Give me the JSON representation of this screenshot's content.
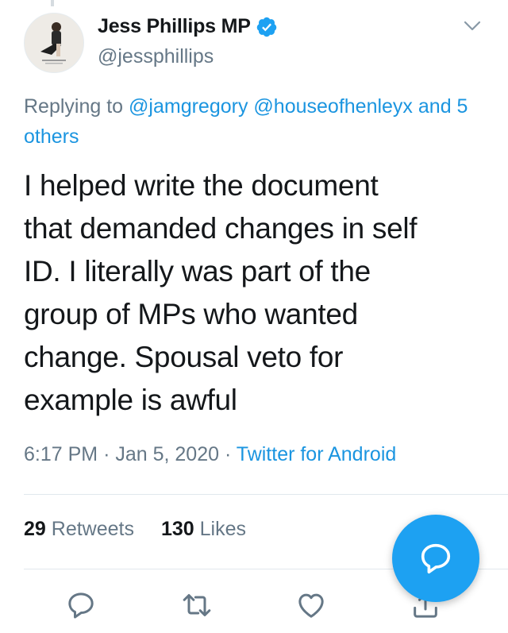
{
  "author": {
    "display_name": "Jess Phillips MP",
    "handle": "@jessphillips",
    "verified_icon": "verified-badge-icon"
  },
  "reply": {
    "prefix": "Replying to",
    "mention_1": "@jamgregory",
    "mention_2": "@houseofhenleyx",
    "others": "and 5 others"
  },
  "tweet": {
    "lines": [
      "I helped write the document",
      "that demanded changes in self",
      "ID. I literally was part of the",
      "group of MPs who wanted",
      "change. Spousal veto for",
      "example is awful"
    ]
  },
  "meta": {
    "time": "6:17 PM",
    "separator": "·",
    "date": "Jan 5, 2020",
    "source": "Twitter for Android"
  },
  "stats": {
    "retweets_count": "29",
    "retweets_label": "Retweets",
    "likes_count": "130",
    "likes_label": "Likes"
  },
  "actions": [
    "reply-icon",
    "retweet-icon",
    "like-icon",
    "share-icon"
  ],
  "colors": {
    "accent": "#1b95e0",
    "fab": "#1da1f2",
    "secondary_text": "#657786",
    "primary_text": "#14171a"
  }
}
